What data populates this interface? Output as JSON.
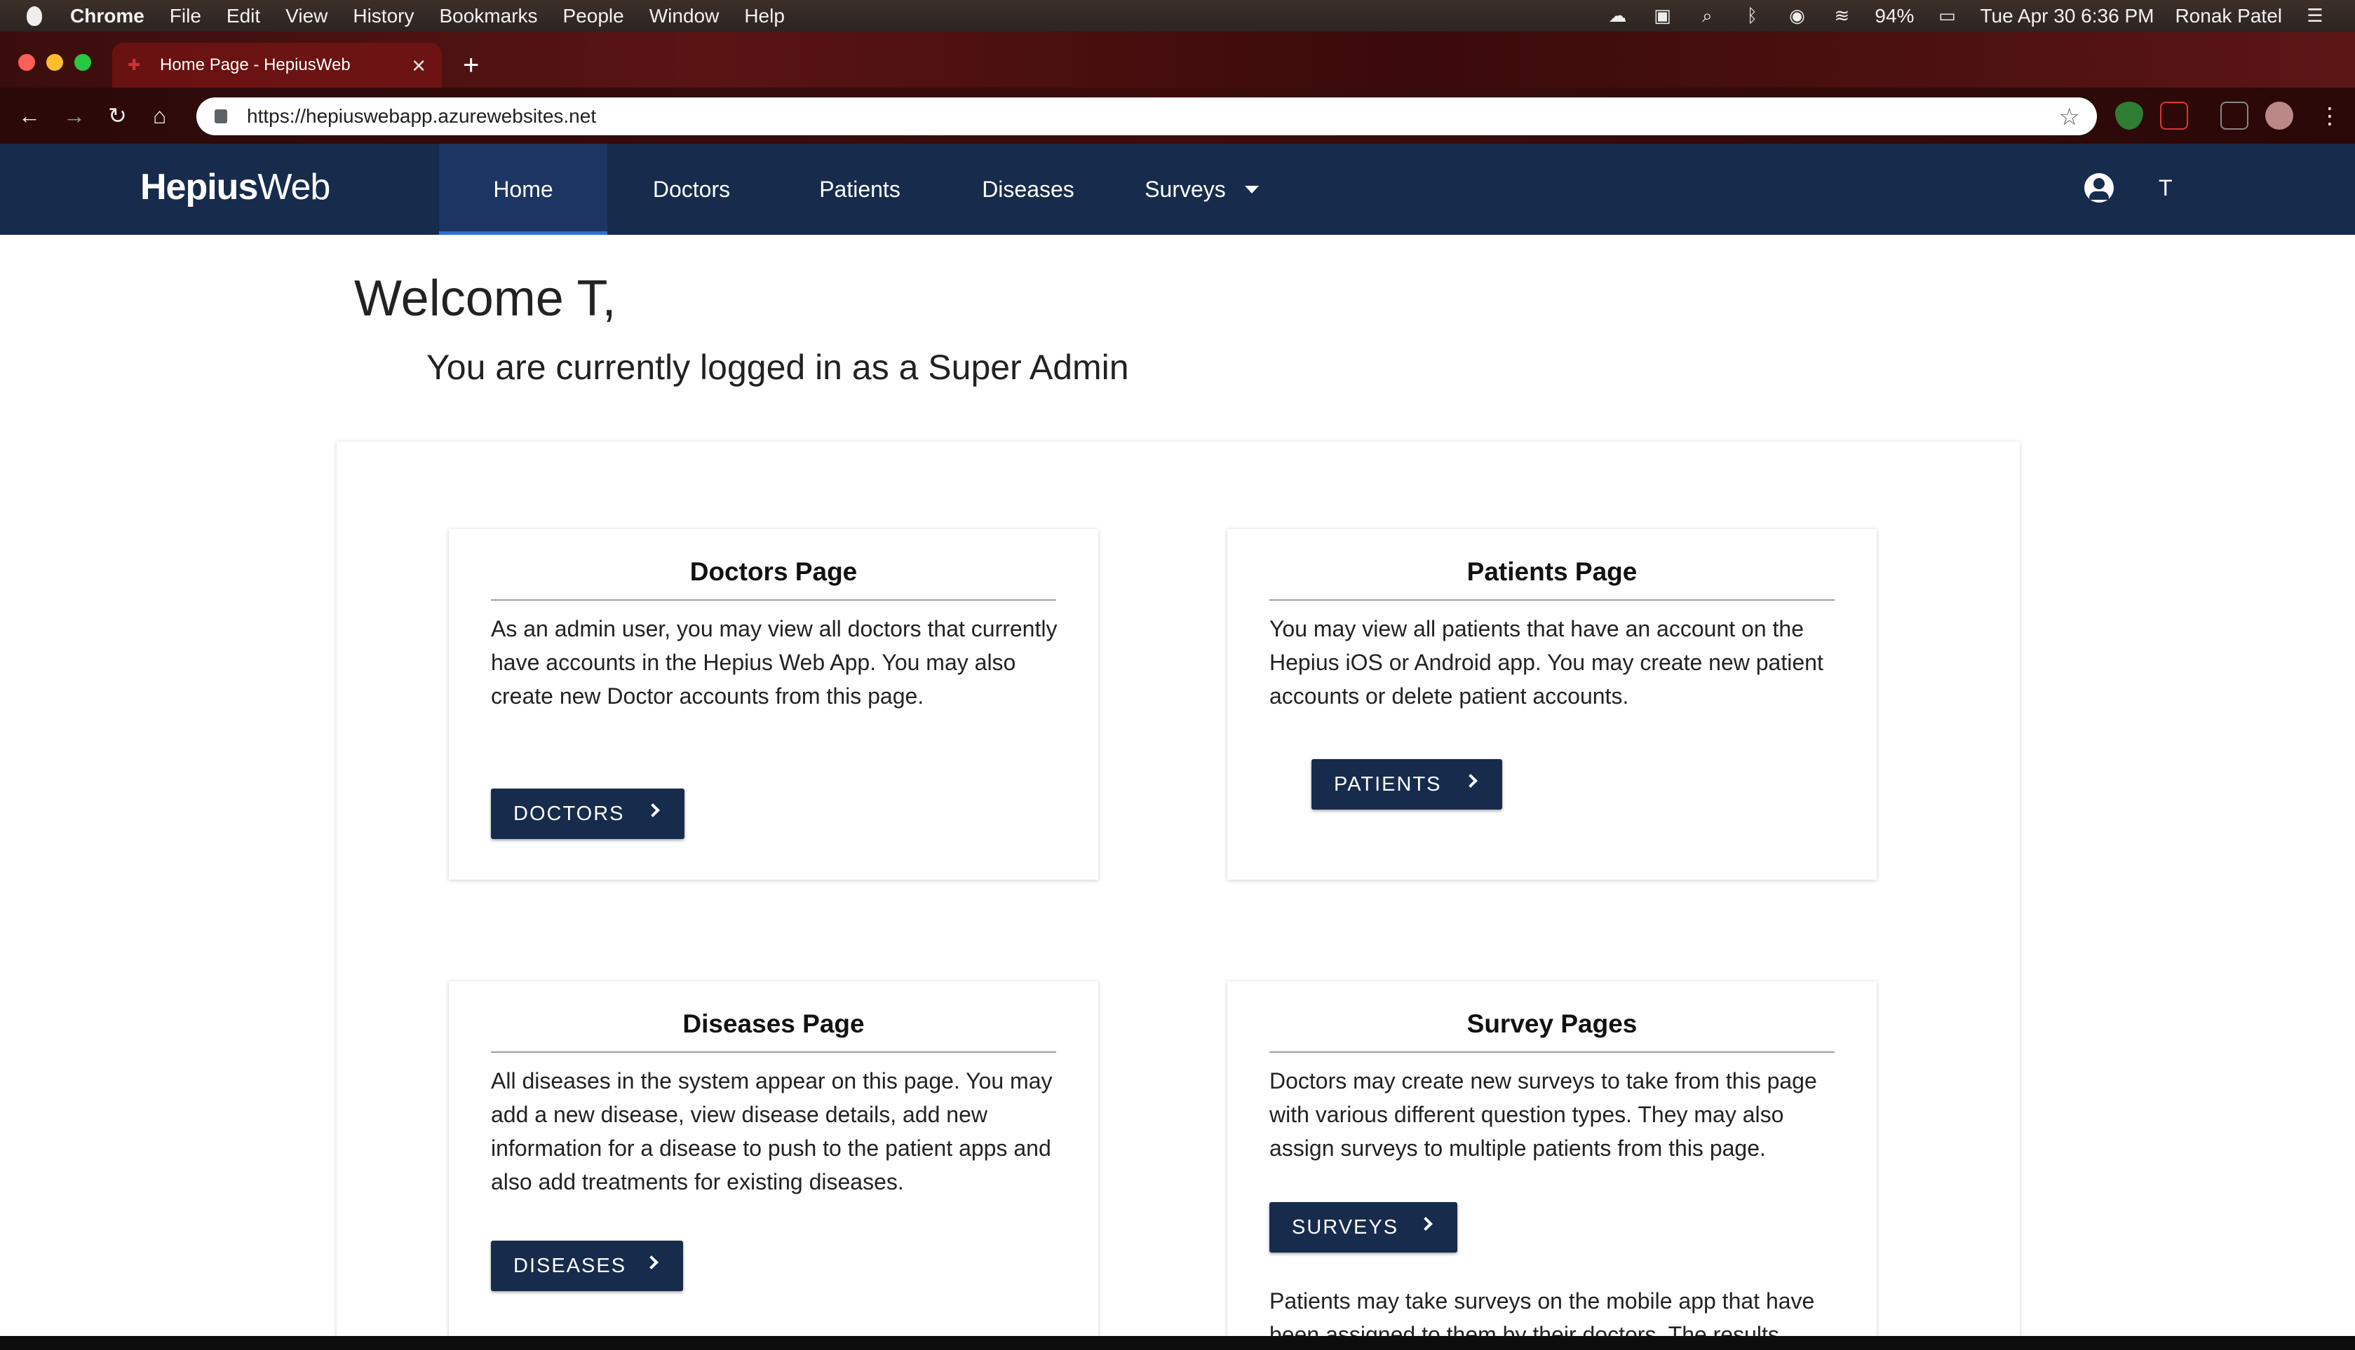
{
  "menubar": {
    "app": "Chrome",
    "items": [
      "File",
      "Edit",
      "View",
      "History",
      "Bookmarks",
      "People",
      "Window",
      "Help"
    ],
    "battery": "94%",
    "datetime": "Tue Apr 30  6:36 PM",
    "user": "Ronak Patel"
  },
  "browser": {
    "tab_title": "Home Page - HepiusWeb",
    "new_tab": "+",
    "url": "https://hepiuswebapp.azurewebsites.net"
  },
  "navbar": {
    "brand_bold": "Hepius",
    "brand_light": "Web",
    "items": [
      "Home",
      "Doctors",
      "Patients",
      "Diseases",
      "Surveys"
    ],
    "active": "Home",
    "user_initial": "T"
  },
  "page": {
    "welcome": "Welcome T,",
    "role_line": "You are currently logged in as a Super Admin"
  },
  "cards": [
    {
      "title": "Doctors Page",
      "body": "As an admin user, you may view all doctors that currently have accounts in the Hepius Web App. You may also create new Doctor accounts from this page.",
      "button": "DOCTORS"
    },
    {
      "title": "Patients Page",
      "body": "You may view all patients that have an account on the Hepius iOS or Android app. You may create new patient accounts or delete patient accounts.",
      "button": "PATIENTS"
    },
    {
      "title": "Diseases Page",
      "body": "All diseases in the system appear on this page. You may add a new disease, view disease details, add new information for a disease to push to the patient apps and also add treatments for existing diseases.",
      "button": "DISEASES"
    },
    {
      "title": "Survey Pages",
      "body": "Doctors may create new surveys to take from this page with various different question types. They may also assign surveys to multiple patients from this page.",
      "button": "SURVEYS",
      "body2": "Patients may take surveys on the mobile app that have been assigned to them by their doctors. The results"
    }
  ],
  "colors": {
    "navbar": "#172b4d",
    "button": "#172b4d",
    "active_underline": "#2f6fd6"
  }
}
